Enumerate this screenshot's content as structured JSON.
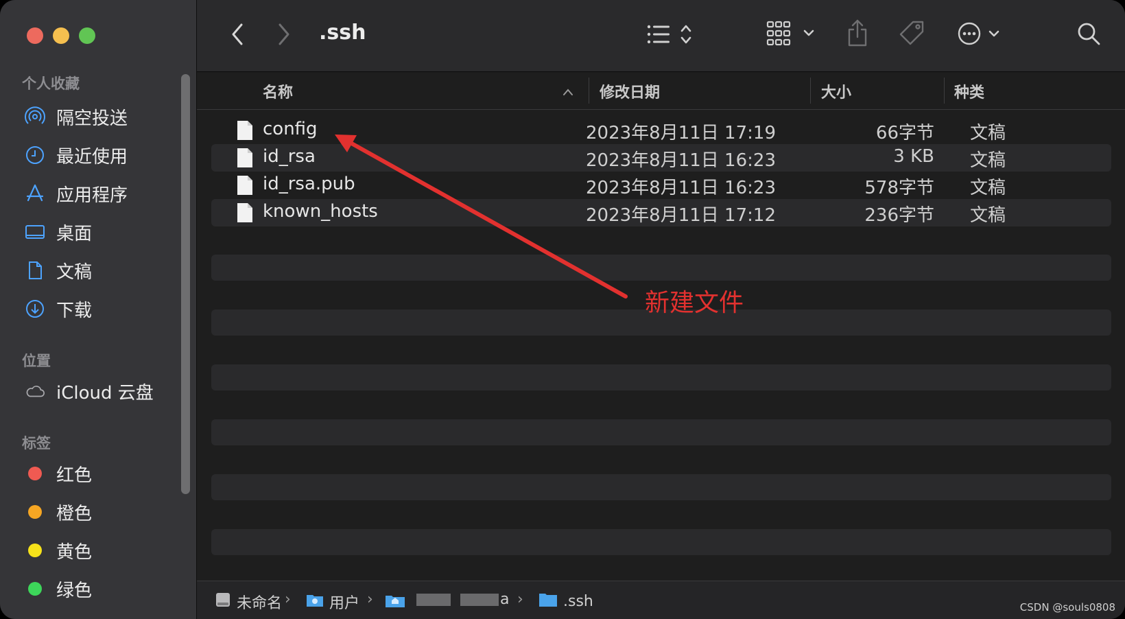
{
  "window": {
    "title": ".ssh"
  },
  "sidebar": {
    "favorites_label": "个人收藏",
    "favorites": [
      {
        "label": "隔空投送",
        "icon": "airdrop-icon"
      },
      {
        "label": "最近使用",
        "icon": "clock-icon"
      },
      {
        "label": "应用程序",
        "icon": "apps-icon"
      },
      {
        "label": "桌面",
        "icon": "desktop-icon"
      },
      {
        "label": "文稿",
        "icon": "document-icon"
      },
      {
        "label": "下载",
        "icon": "download-icon"
      }
    ],
    "locations_label": "位置",
    "locations": [
      {
        "label": "iCloud 云盘",
        "icon": "cloud-icon"
      }
    ],
    "tags_label": "标签",
    "tags": [
      {
        "label": "红色",
        "color": "#f05a52"
      },
      {
        "label": "橙色",
        "color": "#f6a623"
      },
      {
        "label": "黄色",
        "color": "#f6e21a"
      },
      {
        "label": "绿色",
        "color": "#3dd65a"
      }
    ]
  },
  "columns": {
    "name": "名称",
    "date": "修改日期",
    "size": "大小",
    "kind": "种类"
  },
  "files": [
    {
      "name": "config",
      "date": "2023年8月11日 17:19",
      "size": "66字节",
      "kind": "文稿"
    },
    {
      "name": "id_rsa",
      "date": "2023年8月11日 16:23",
      "size": "3 KB",
      "kind": "文稿"
    },
    {
      "name": "id_rsa.pub",
      "date": "2023年8月11日 16:23",
      "size": "578字节",
      "kind": "文稿"
    },
    {
      "name": "known_hosts",
      "date": "2023年8月11日 17:12",
      "size": "236字节",
      "kind": "文稿"
    }
  ],
  "pathbar": {
    "items": [
      {
        "label": "未命名"
      },
      {
        "label": "用户"
      },
      {
        "label": "a"
      },
      {
        "label": ".ssh"
      }
    ]
  },
  "annotation": {
    "text": "新建文件",
    "color": "#e2312f"
  },
  "watermark": "CSDN @souls0808"
}
